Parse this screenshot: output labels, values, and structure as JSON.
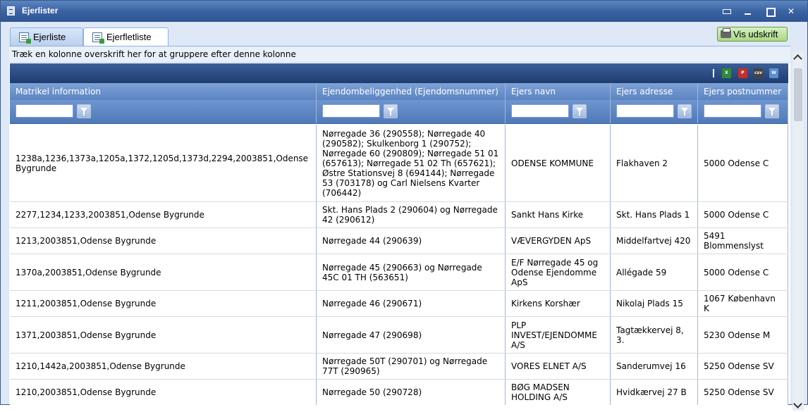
{
  "window": {
    "title": "Ejerlister"
  },
  "tabs": [
    {
      "label": "Ejerliste",
      "active": false
    },
    {
      "label": "Ejerfletliste",
      "active": true
    }
  ],
  "toolbar": {
    "print_label": "Vis udskrift"
  },
  "grid": {
    "group_hint": "Træk en kolonne overskrift her for at gruppere efter denne kolonne",
    "export_icons": [
      "excel-export-icon",
      "pdf-export-icon",
      "csv-export-icon",
      "word-export-icon"
    ],
    "columns": [
      "Matrikel information",
      "Ejendombeliggenhed (Ejendomsnummer)",
      "Ejers navn",
      "Ejers adresse",
      "Ejers postnummer"
    ],
    "rows": [
      {
        "matrikel": "1238a,1236,1373a,1205a,1372,1205d,1373d,2294,2003851,Odense Bygrunde",
        "ejendom": "Nørregade 36 (290558); Nørregade 40 (290582); Skulkenborg 1 (290752); Nørregade 60 (290809); Nørregade 51 01 (657613); Nørregade 51 02 Th (657621); Østre Stationsvej 8 (694144); Nørregade 53 (703178) og Carl Nielsens Kvarter (706442)",
        "navn": "ODENSE KOMMUNE",
        "adresse": "Flakhaven 2",
        "postnummer": "5000 Odense C"
      },
      {
        "matrikel": "2277,1234,1233,2003851,Odense Bygrunde",
        "ejendom": "Skt. Hans Plads 2 (290604) og Nørregade 42 (290612)",
        "navn": "Sankt Hans Kirke",
        "adresse": "Skt. Hans Plads 1",
        "postnummer": "5000 Odense C"
      },
      {
        "matrikel": "1213,2003851,Odense Bygrunde",
        "ejendom": "Nørregade 44 (290639)",
        "navn": "VÆVERGYDEN ApS",
        "adresse": "Middelfartvej 420",
        "postnummer": "5491 Blommenslyst"
      },
      {
        "matrikel": "1370a,2003851,Odense Bygrunde",
        "ejendom": "Nørregade 45 (290663) og Nørregade 45C 01 TH (563651)",
        "navn": "E/F Nørregade 45 og Odense Ejendomme ApS",
        "adresse": "Allégade 59",
        "postnummer": "5000 Odense C"
      },
      {
        "matrikel": "1211,2003851,Odense Bygrunde",
        "ejendom": "Nørregade 46 (290671)",
        "navn": "Kirkens Korshær",
        "adresse": "Nikolaj Plads 15",
        "postnummer": "1067 København K"
      },
      {
        "matrikel": "1371,2003851,Odense Bygrunde",
        "ejendom": "Nørregade 47 (290698)",
        "navn": "PLP INVEST/EJENDOMME A/S",
        "adresse": "Tagtækkervej 8, 3.",
        "postnummer": "5230 Odense M"
      },
      {
        "matrikel": "1210,1442a,2003851,Odense Bygrunde",
        "ejendom": "Nørregade 50T (290701) og Nørregade 77T (290965)",
        "navn": "VORES ELNET A/S",
        "adresse": "Sanderumvej 16",
        "postnummer": "5250 Odense SV"
      },
      {
        "matrikel": "1210,2003851,Odense Bygrunde",
        "ejendom": "Nørregade 50 (290728)",
        "navn": "BØG MADSEN HOLDING A/S",
        "adresse": "Hvidkærvej 27 B",
        "postnummer": "5250 Odense SV"
      }
    ]
  }
}
